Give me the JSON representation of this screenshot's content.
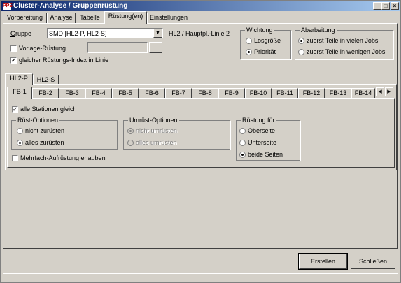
{
  "window": {
    "title": "Cluster-Analyse / Gruppenrüstung",
    "app_icon": "PPS"
  },
  "main_tabs": [
    {
      "label": "Vorbereitung"
    },
    {
      "label": "Analyse"
    },
    {
      "label": "Tabelle"
    },
    {
      "label": "Rüstung(en)"
    },
    {
      "label": "Einstellungen"
    }
  ],
  "gruppe": {
    "label": "Gruppe",
    "value": "SMD  [HL2-P, HL2-S]",
    "line_info": "HL2 / Hauptpl.-Linie 2",
    "vorlage_label": "Vorlage-Rüstung",
    "vorlage_value": "",
    "vorlage_browse": "...",
    "gleicher_index_label": "gleicher Rüstungs-Index in Linie"
  },
  "wichtung": {
    "title": "Wichtung",
    "opt1": "Losgröße",
    "opt2": "Priorität"
  },
  "abarbeitung": {
    "title": "Abarbeitung",
    "opt1": "zuerst Teile in vielen Jobs",
    "opt2": "zuerst Teile in wenigen Jobs"
  },
  "line_tabs": [
    {
      "label": "HL2-P"
    },
    {
      "label": "HL2-S"
    }
  ],
  "fb_tabs": [
    {
      "label": "FB-1"
    },
    {
      "label": "FB-2"
    },
    {
      "label": "FB-3"
    },
    {
      "label": "FB-4"
    },
    {
      "label": "FB-5"
    },
    {
      "label": "FB-6"
    },
    {
      "label": "FB-7"
    },
    {
      "label": "FB-8"
    },
    {
      "label": "FB-9"
    },
    {
      "label": "FB-10"
    },
    {
      "label": "FB-11"
    },
    {
      "label": "FB-12"
    },
    {
      "label": "FB-13"
    },
    {
      "label": "FB-14"
    }
  ],
  "stations": {
    "alle_label": "alle Stationen gleich",
    "rust": {
      "title": "Rüst-Optionen",
      "opt1": "nicht zurüsten",
      "opt2": "alles zurüsten"
    },
    "umrust": {
      "title": "Umrüst-Optionen",
      "opt1": "nicht umrüsten",
      "opt2": "alles umrüsten"
    },
    "mehrfach_label": "Mehrfach-Aufrüstung erlauben",
    "rustung_fur": {
      "title": "Rüstung für",
      "opt1": "Oberseite",
      "opt2": "Unterseite",
      "opt3": "beide Seiten"
    }
  },
  "buttons": {
    "erstellen": "Erstellen",
    "schliessen": "Schließen"
  }
}
